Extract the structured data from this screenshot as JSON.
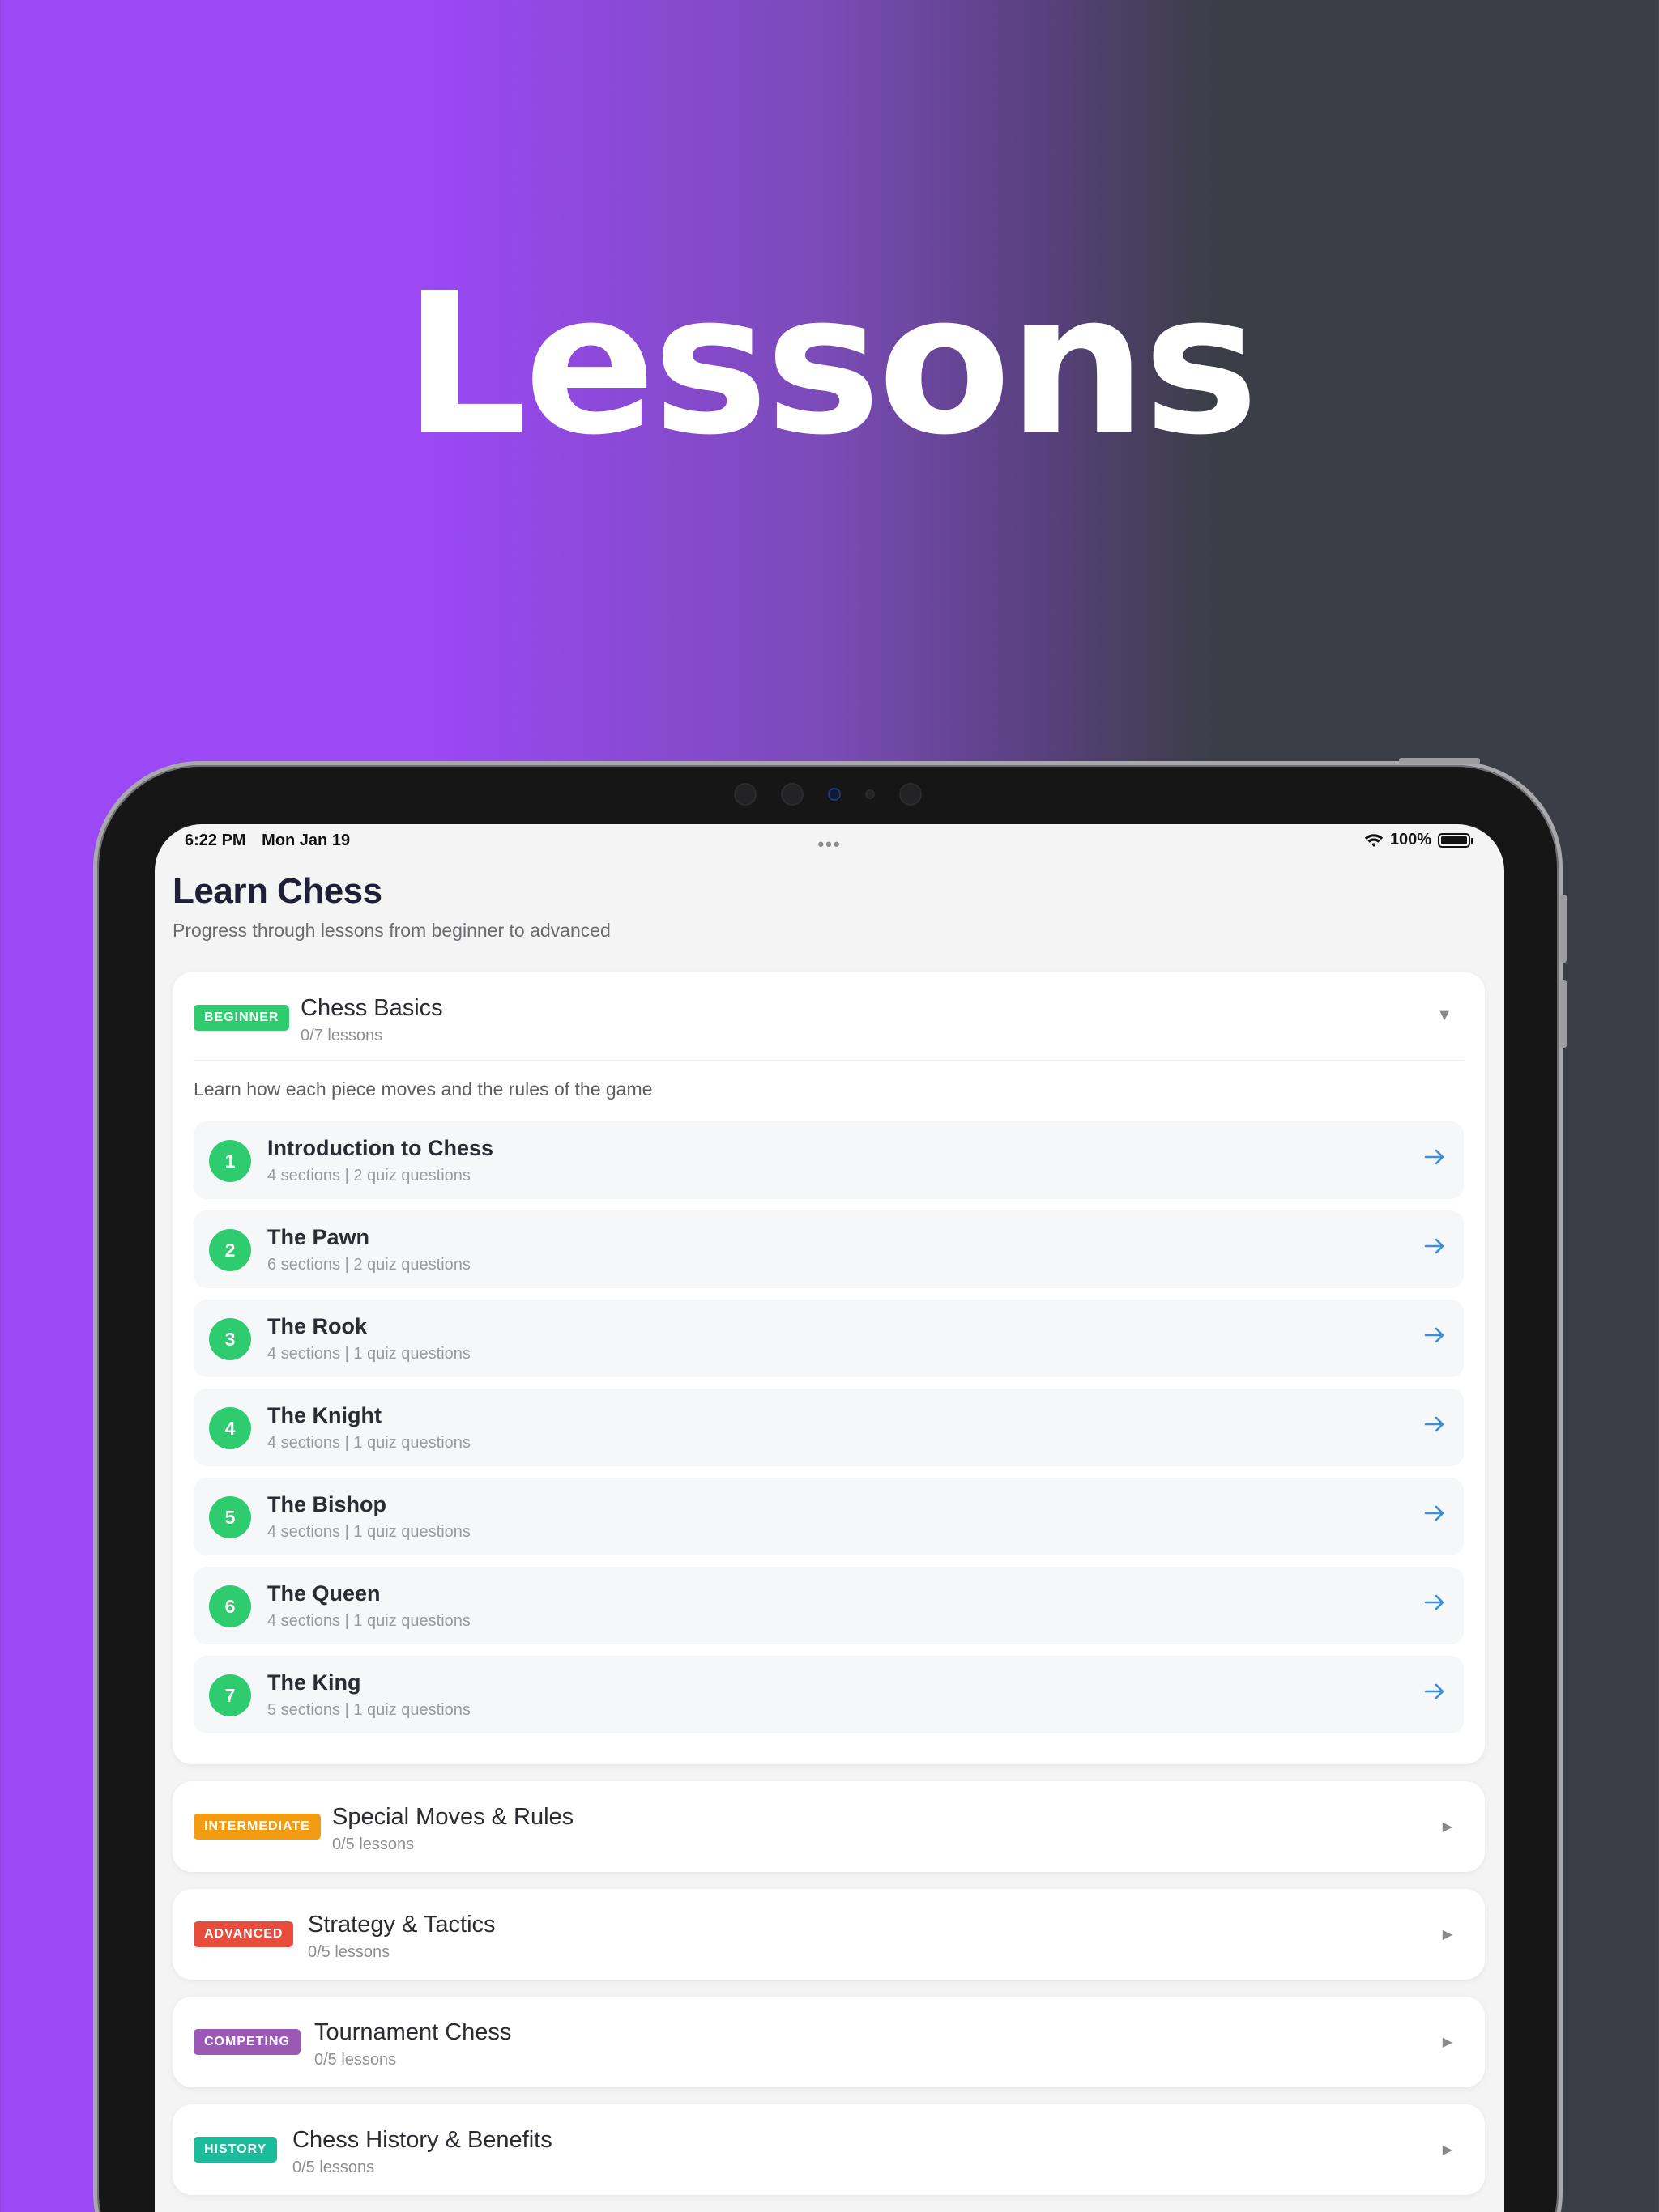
{
  "hero": {
    "title": "Lessons"
  },
  "status_bar": {
    "time": "6:22 PM",
    "date": "Mon Jan 19",
    "dots": "•••",
    "battery": "100%",
    "battery_level": 1.0
  },
  "page": {
    "title": "Learn Chess",
    "subtitle": "Progress through lessons from beginner to advanced"
  },
  "colors": {
    "beginner": "#2ecb6f",
    "intermediate": "#f39c12",
    "advanced": "#e74c3c",
    "competing": "#9b59b6",
    "history": "#1abc9c",
    "arrow": "#3a8fd9"
  },
  "sections": [
    {
      "badge": "BEGINNER",
      "title": "Chess Basics",
      "count": "0/7 lessons",
      "expanded": true,
      "chevron": "▼",
      "description": "Learn how each piece moves and the rules of the game",
      "lessons": [
        {
          "num": "1",
          "title": "Introduction to Chess",
          "meta": "4 sections | 2 quiz questions"
        },
        {
          "num": "2",
          "title": "The Pawn",
          "meta": "6 sections | 2 quiz questions"
        },
        {
          "num": "3",
          "title": "The Rook",
          "meta": "4 sections | 1 quiz questions"
        },
        {
          "num": "4",
          "title": "The Knight",
          "meta": "4 sections | 1 quiz questions"
        },
        {
          "num": "5",
          "title": "The Bishop",
          "meta": "4 sections | 1 quiz questions"
        },
        {
          "num": "6",
          "title": "The Queen",
          "meta": "4 sections | 1 quiz questions"
        },
        {
          "num": "7",
          "title": "The King",
          "meta": "5 sections | 1 quiz questions"
        }
      ]
    },
    {
      "badge": "INTERMEDIATE",
      "title": "Special Moves & Rules",
      "count": "0/5 lessons",
      "expanded": false,
      "chevron": "▶"
    },
    {
      "badge": "ADVANCED",
      "title": "Strategy & Tactics",
      "count": "0/5 lessons",
      "expanded": false,
      "chevron": "▶"
    },
    {
      "badge": "COMPETING",
      "title": "Tournament Chess",
      "count": "0/5 lessons",
      "expanded": false,
      "chevron": "▶"
    },
    {
      "badge": "HISTORY",
      "title": "Chess History & Benefits",
      "count": "0/5 lessons",
      "expanded": false,
      "chevron": "▶"
    }
  ]
}
